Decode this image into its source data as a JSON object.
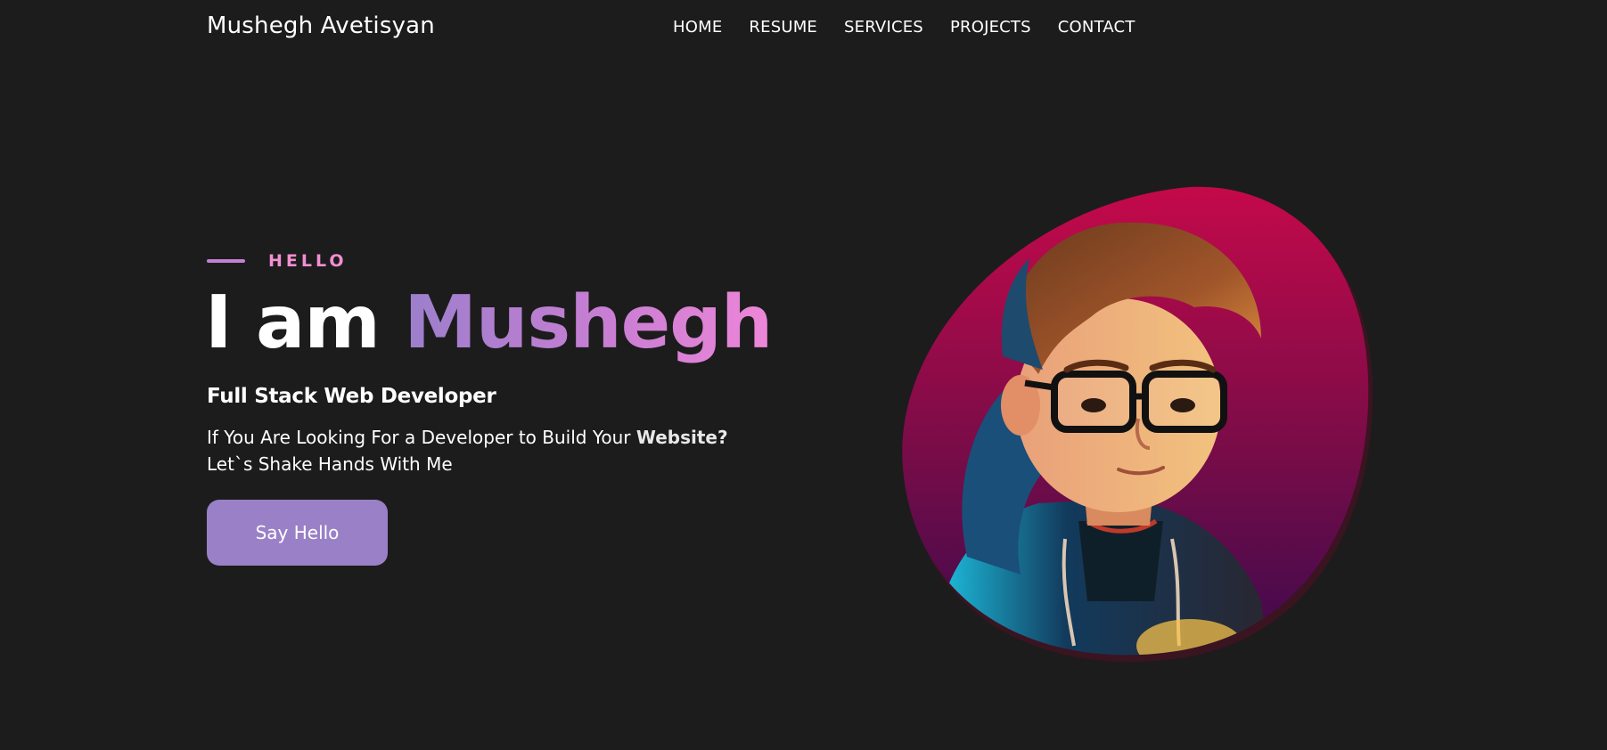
{
  "header": {
    "brand": "Mushegh Avetisyan",
    "nav": [
      "HOME",
      "RESUME",
      "SERVICES",
      "PROJECTS",
      "CONTACT"
    ]
  },
  "hero": {
    "eyebrow": "HELLO",
    "headline_prefix": "I am",
    "headline_name": "Mushegh",
    "role": "Full Stack Web Developer",
    "description_part1": "If You Are Looking For a Developer to Build Your ",
    "description_bold": "Website?",
    "description_part2": " Let`s Shake Hands With Me",
    "cta_label": "Say Hello",
    "avatar_icon": "avatar-illustration"
  },
  "colors": {
    "background": "#1c1c1c",
    "accent_purple": "#9a80c6",
    "accent_pink": "#f28fd2",
    "blob_top": "#c20a45",
    "blob_bottom": "#4a0a4e"
  }
}
